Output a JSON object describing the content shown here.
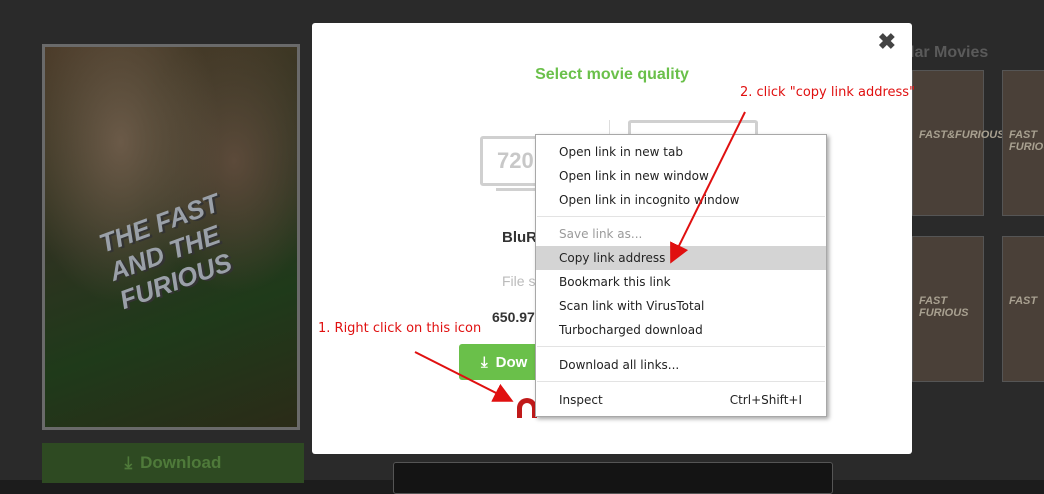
{
  "background": {
    "poster_title": "THE FAST AND THE FURIOUS",
    "download_label": "Download",
    "popular_title": "lar Movies",
    "thumbs": [
      "FAST&FURIOUS",
      "FAST FURIOUS",
      "FAST FURIOUS",
      "FAST"
    ]
  },
  "modal": {
    "close_label": "✖",
    "title": "Select movie quality",
    "left_quality": {
      "badge": "720",
      "type": "BluR",
      "size_label": "File s",
      "size": "650.97",
      "download_label": "Dow"
    }
  },
  "context_menu": {
    "items": [
      {
        "label": "Open link in new tab"
      },
      {
        "label": "Open link in new window"
      },
      {
        "label": "Open link in incognito window"
      },
      {
        "label": "Save link as..."
      },
      {
        "label": "Copy link address"
      },
      {
        "label": "Bookmark this link"
      },
      {
        "label": "Scan link with VirusTotal"
      },
      {
        "label": "Turbocharged download"
      },
      {
        "label": "Download all links..."
      },
      {
        "label": "Inspect",
        "shortcut": "Ctrl+Shift+I"
      }
    ]
  },
  "annotations": {
    "step1": "1. Right click on this icon",
    "step2": "2. click \"copy link address\""
  },
  "colors": {
    "accent_green": "#6ac04a",
    "annotation_red": "#e01010",
    "magnet_red": "#c01a1a",
    "menu_hover": "#d4d4d4"
  },
  "icons": [
    "close-icon",
    "download-icon",
    "magnet-icon",
    "monitor-icon"
  ]
}
